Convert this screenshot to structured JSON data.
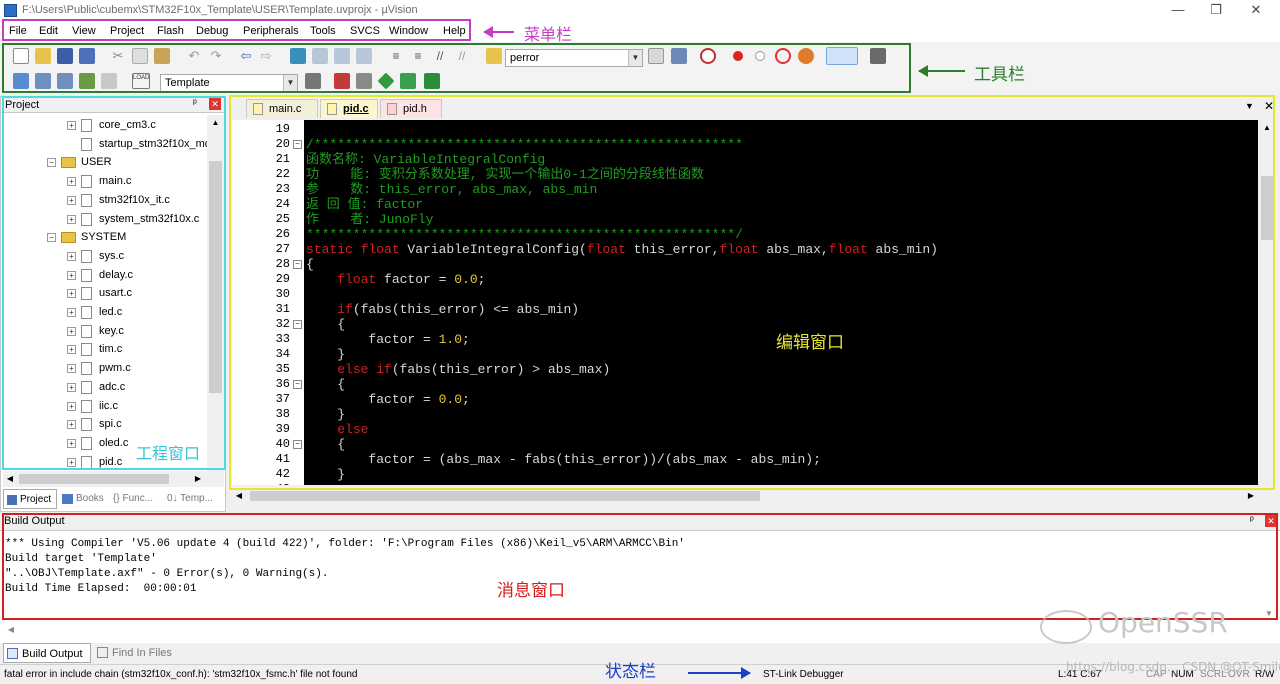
{
  "window": {
    "title": "F:\\Users\\Public\\cubemx\\STM32F10x_Template\\USER\\Template.uvprojx - µVision",
    "min_glyph": "—",
    "max_glyph": "❐",
    "close_glyph": "✕"
  },
  "menu": [
    "File",
    "Edit",
    "View",
    "Project",
    "Flash",
    "Debug",
    "Peripherals",
    "Tools",
    "SVCS",
    "Window",
    "Help"
  ],
  "toolbar": {
    "search_combo": "perror",
    "target_combo": "Template",
    "load_label": "LOAD"
  },
  "project": {
    "title": "Project",
    "pin_glyph": "ᵖ",
    "close_glyph": "✕",
    "items": [
      {
        "type": "file",
        "label": "core_cm3.c",
        "expandable": true
      },
      {
        "type": "file",
        "label": "startup_stm32f10x_md",
        "expandable": false
      },
      {
        "type": "folder",
        "label": "USER"
      },
      {
        "type": "file",
        "label": "main.c",
        "expandable": true
      },
      {
        "type": "file",
        "label": "stm32f10x_it.c",
        "expandable": true
      },
      {
        "type": "file",
        "label": "system_stm32f10x.c",
        "expandable": true
      },
      {
        "type": "folder",
        "label": "SYSTEM"
      },
      {
        "type": "file",
        "label": "sys.c",
        "expandable": true
      },
      {
        "type": "file",
        "label": "delay.c",
        "expandable": true
      },
      {
        "type": "file",
        "label": "usart.c",
        "expandable": true
      },
      {
        "type": "file",
        "label": "led.c",
        "expandable": true
      },
      {
        "type": "file",
        "label": "key.c",
        "expandable": true
      },
      {
        "type": "file",
        "label": "tim.c",
        "expandable": true
      },
      {
        "type": "file",
        "label": "pwm.c",
        "expandable": true
      },
      {
        "type": "file",
        "label": "adc.c",
        "expandable": true
      },
      {
        "type": "file",
        "label": "iic.c",
        "expandable": true
      },
      {
        "type": "file",
        "label": "spi.c",
        "expandable": true
      },
      {
        "type": "file",
        "label": "oled.c",
        "expandable": true
      },
      {
        "type": "file",
        "label": "pid.c",
        "expandable": true
      }
    ],
    "tabs": [
      "Project",
      "Books",
      "{} Func...",
      "0↓ Temp..."
    ]
  },
  "editor": {
    "tabs": [
      "main.c",
      "pid.c",
      "pid.h"
    ],
    "active_tab": "pid.c",
    "dropdown_glyph": "▼",
    "close_glyph": "✕",
    "lines": [
      {
        "n": "19",
        "fold": "",
        "segs": []
      },
      {
        "n": "20",
        "fold": "⊟",
        "segs": [
          {
            "c": "cm",
            "t": "/*******************************************************"
          }
        ]
      },
      {
        "n": "21",
        "fold": "",
        "segs": [
          {
            "c": "cm",
            "t": "函数名称: VariableIntegralConfig"
          }
        ]
      },
      {
        "n": "22",
        "fold": "",
        "segs": [
          {
            "c": "cm",
            "t": "功    能: 变积分系数处理, 实现一个输出0-1之间的分段线性函数"
          }
        ]
      },
      {
        "n": "23",
        "fold": "",
        "segs": [
          {
            "c": "cm",
            "t": "参    数: this_error, abs_max, abs_min"
          }
        ]
      },
      {
        "n": "24",
        "fold": "",
        "segs": [
          {
            "c": "cm",
            "t": "返 回 值: factor"
          }
        ]
      },
      {
        "n": "25",
        "fold": "",
        "segs": [
          {
            "c": "cm",
            "t": "作    者: JunoFly"
          }
        ]
      },
      {
        "n": "26",
        "fold": "",
        "segs": [
          {
            "c": "cm",
            "t": "*******************************************************/"
          }
        ]
      },
      {
        "n": "27",
        "fold": "",
        "segs": [
          {
            "c": "kw",
            "t": "static float "
          },
          {
            "c": "tx",
            "t": "VariableIntegralConfig("
          },
          {
            "c": "kw",
            "t": "float "
          },
          {
            "c": "tx",
            "t": "this_error,"
          },
          {
            "c": "kw",
            "t": "float "
          },
          {
            "c": "tx",
            "t": "abs_max,"
          },
          {
            "c": "kw",
            "t": "float "
          },
          {
            "c": "tx",
            "t": "abs_min)"
          }
        ]
      },
      {
        "n": "28",
        "fold": "⊟",
        "segs": [
          {
            "c": "tx",
            "t": "{"
          }
        ]
      },
      {
        "n": "29",
        "fold": "",
        "segs": [
          {
            "c": "tx",
            "t": "    "
          },
          {
            "c": "kw",
            "t": "float "
          },
          {
            "c": "tx",
            "t": "factor = "
          },
          {
            "c": "nm",
            "t": "0.0"
          },
          {
            "c": "tx",
            "t": ";"
          }
        ]
      },
      {
        "n": "30",
        "fold": "",
        "segs": []
      },
      {
        "n": "31",
        "fold": "",
        "segs": [
          {
            "c": "tx",
            "t": "    "
          },
          {
            "c": "kw",
            "t": "if"
          },
          {
            "c": "tx",
            "t": "(fabs(this_error) <= abs_min)"
          }
        ]
      },
      {
        "n": "32",
        "fold": "⊟",
        "segs": [
          {
            "c": "tx",
            "t": "    {"
          }
        ]
      },
      {
        "n": "33",
        "fold": "",
        "segs": [
          {
            "c": "tx",
            "t": "        factor = "
          },
          {
            "c": "nm",
            "t": "1.0"
          },
          {
            "c": "tx",
            "t": ";"
          }
        ]
      },
      {
        "n": "34",
        "fold": "",
        "segs": [
          {
            "c": "tx",
            "t": "    }"
          }
        ]
      },
      {
        "n": "35",
        "fold": "",
        "segs": [
          {
            "c": "tx",
            "t": "    "
          },
          {
            "c": "kw",
            "t": "else if"
          },
          {
            "c": "tx",
            "t": "(fabs(this_error) > abs_max)"
          }
        ]
      },
      {
        "n": "36",
        "fold": "⊟",
        "segs": [
          {
            "c": "tx",
            "t": "    {"
          }
        ]
      },
      {
        "n": "37",
        "fold": "",
        "segs": [
          {
            "c": "tx",
            "t": "        factor = "
          },
          {
            "c": "nm",
            "t": "0.0"
          },
          {
            "c": "tx",
            "t": ";"
          }
        ]
      },
      {
        "n": "38",
        "fold": "",
        "segs": [
          {
            "c": "tx",
            "t": "    }"
          }
        ]
      },
      {
        "n": "39",
        "fold": "",
        "segs": [
          {
            "c": "tx",
            "t": "    "
          },
          {
            "c": "kw",
            "t": "else"
          }
        ]
      },
      {
        "n": "40",
        "fold": "⊟",
        "segs": [
          {
            "c": "tx",
            "t": "    {"
          }
        ]
      },
      {
        "n": "41",
        "fold": "",
        "segs": [
          {
            "c": "tx",
            "t": "        factor = (abs_max - fabs(this_error))/(abs_max - abs_min);"
          }
        ]
      },
      {
        "n": "42",
        "fold": "",
        "segs": [
          {
            "c": "tx",
            "t": "    }"
          }
        ]
      },
      {
        "n": "43",
        "fold": "",
        "segs": []
      }
    ]
  },
  "build": {
    "title": "Build Output",
    "lines": [
      "*** Using Compiler 'V5.06 update 4 (build 422)', folder: 'F:\\Program Files (x86)\\Keil_v5\\ARM\\ARMCC\\Bin'",
      "Build target 'Template'",
      "\"..\\OBJ\\Template.axf\" - 0 Error(s), 0 Warning(s).",
      "Build Time Elapsed:  00:00:01"
    ],
    "tabs": [
      "Build Output",
      "Find In Files"
    ]
  },
  "status": {
    "message": "fatal error in include chain (stm32f10x_conf.h): 'stm32f10x_fsmc.h' file not found",
    "debugger": "ST-Link Debugger",
    "position": "L:41 C:67",
    "caps": "CAP",
    "num": "NUM",
    "scrl": "SCRL",
    "ovr": "OVR",
    "rw": "R/W"
  },
  "annotations": {
    "menubar": "菜单栏",
    "toolbar": "工具栏",
    "project": "工程窗口",
    "editor": "编辑窗口",
    "messages": "消息窗口",
    "status": "状态栏"
  },
  "watermark": {
    "brand": "OpenSSR",
    "credit": "https://blog.csdn... CSDN @QT-Smile"
  },
  "colors": {
    "menubar_box": "#c43cc4",
    "toolbar_box": "#2e7d2e",
    "project_box": "#4fd8e0",
    "editor_box": "#e6e632",
    "build_box": "#cc2222",
    "annotation_red": "#d81b1b",
    "annotation_blue": "#1e40c8"
  }
}
